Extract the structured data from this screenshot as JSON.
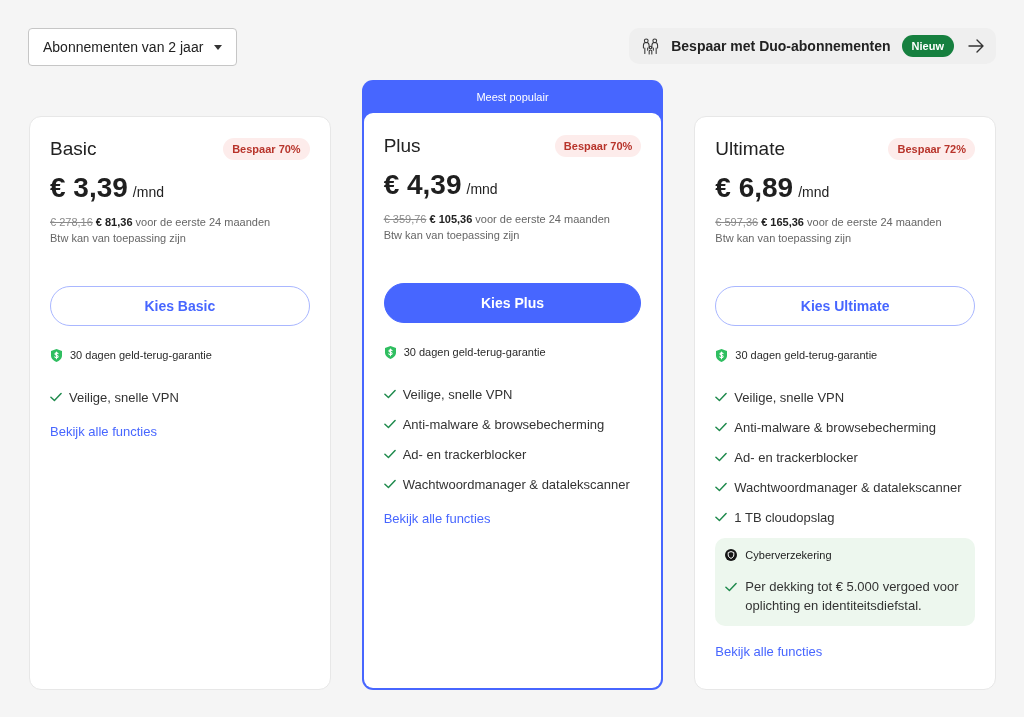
{
  "plan_selector": {
    "value": "Abonnementen van 2 jaar"
  },
  "promo_banner": {
    "text": "Bespaar met Duo-abonnementen",
    "badge": "Nieuw"
  },
  "plans": [
    {
      "name": "Basic",
      "featured": false,
      "badge": "Bespaar 70%",
      "price": "€ 3,39",
      "unit": "/mnd",
      "old_total": "€ 278,16",
      "total_note": "**€ 81,36** voor de eerste 24 maanden",
      "tax_note": "Btw kan van toepassing zijn",
      "button": "Kies Basic",
      "guarantee": "30 dagen geld-terug-garantie",
      "features": [
        "Veilige, snelle VPN"
      ],
      "link": "Bekijk alle functies"
    },
    {
      "name": "Plus",
      "featured": true,
      "ribbon": "Meest populair",
      "badge": "Bespaar 70%",
      "price": "€ 4,39",
      "unit": "/mnd",
      "old_total": "€ 359,76",
      "total_note": "**€ 105,36** voor de eerste 24 maanden",
      "tax_note": "Btw kan van toepassing zijn",
      "button": "Kies Plus",
      "guarantee": "30 dagen geld-terug-garantie",
      "features": [
        "Veilige, snelle VPN",
        "Anti-malware & browsebecherming",
        "Ad- en trackerblocker",
        "Wachtwoordmanager & datalekscanner"
      ],
      "link": "Bekijk alle functies"
    },
    {
      "name": "Ultimate",
      "featured": false,
      "badge": "Bespaar 72%",
      "price": "€ 6,89",
      "unit": "/mnd",
      "old_total": "€ 597,36",
      "total_note": "**€ 165,36** voor de eerste 24 maanden",
      "tax_note": "Btw kan van toepassing zijn",
      "button": "Kies Ultimate",
      "guarantee": "30 dagen geld-terug-garantie",
      "features": [
        "Veilige, snelle VPN",
        "Anti-malware & browsebecherming",
        "Ad- en trackerblocker",
        "Wachtwoordmanager & datalekscanner",
        "1 TB cloudopslag"
      ],
      "insurance": {
        "title": "Cyberverzekering",
        "items": [
          "Per dekking tot € 5.000 vergoed voor oplichting en identiteitsdiefstal."
        ]
      },
      "link": "Bekijk alle functies"
    }
  ]
}
